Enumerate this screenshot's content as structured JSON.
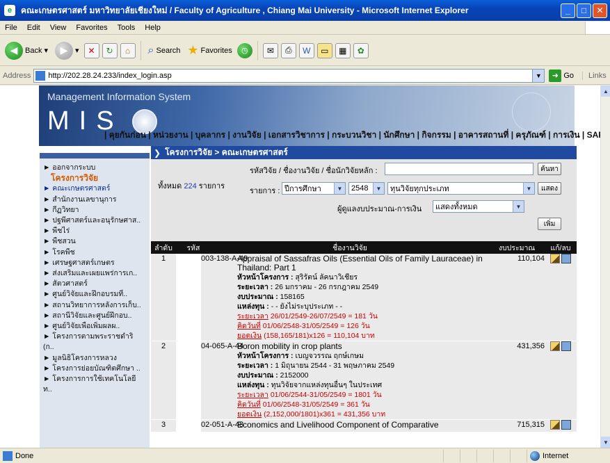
{
  "window": {
    "title": "คณะเกษตรศาสตร์ มหาวิทยาลัยเชียงใหม่ / Faculty of Agriculture , Chiang Mai University   - Microsoft Internet Explorer",
    "buttons": {
      "minimize": "_",
      "maximize": "□",
      "close": "✕"
    }
  },
  "menu": [
    "File",
    "Edit",
    "View",
    "Favorites",
    "Tools",
    "Help"
  ],
  "toolbar": {
    "back": "Back",
    "search": "Search",
    "favorites": "Favorites"
  },
  "address": {
    "label": "Address",
    "url": "http://202.28.24.233/index_login.asp",
    "go": "Go",
    "links": "Links"
  },
  "banner": {
    "subtitle": "Management Information System",
    "mis": "MIS"
  },
  "topnav": [
    "คุยกันก่อน",
    "หน่วยงาน",
    "บุคลากร",
    "งานวิจัย",
    "เอกสารวิชาการ",
    "กระบวนวิชา",
    "นักศึกษา",
    "กิจกรรม",
    "อาคารสถานที่",
    "ครุภัณฑ์",
    "การเงิน",
    "SAR"
  ],
  "sidebar": {
    "items": [
      {
        "label": "► ออกจากระบบ",
        "type": "normal"
      },
      {
        "label": "โครงการวิจัย",
        "type": "active"
      },
      {
        "label": "► คณะเกษตรศาสตร์",
        "type": "sel"
      },
      {
        "label": "► สำนักงานเลขานุการ",
        "type": "normal"
      },
      {
        "label": "► กีฏวิทยา",
        "type": "normal"
      },
      {
        "label": "► ปฐพีศาสตร์และอนุรักษศาส..",
        "type": "normal"
      },
      {
        "label": "► พืชไร่",
        "type": "normal"
      },
      {
        "label": "► พืชสวน",
        "type": "normal"
      },
      {
        "label": "► โรคพืช",
        "type": "normal"
      },
      {
        "label": "► เศรษฐศาสตร์เกษตร",
        "type": "normal"
      },
      {
        "label": "► ส่งเสริมและเผยแพร่การเก..",
        "type": "normal"
      },
      {
        "label": "► สัตวศาสตร์",
        "type": "normal"
      },
      {
        "label": "► ศูนย์วิจัยและฝึกอบรมที่..",
        "type": "normal"
      },
      {
        "label": "► สถานวิทยาการหลังการเก็บ..",
        "type": "normal"
      },
      {
        "label": "► สถานีวิจัยและศูนย์ฝึกอบ..",
        "type": "normal"
      },
      {
        "label": "► ศูนย์วิจัยเพื่อเพิ่มผลผ..",
        "type": "normal"
      },
      {
        "label": "► โครงการตามพระราชดำริ",
        "type": "normal"
      },
      {
        "label": "(ก..",
        "type": "normal"
      },
      {
        "label": "► มูลนิธิโครงการหลวง",
        "type": "normal"
      },
      {
        "label": "► โครงการย่อยบัณฑิตศึกษา ..",
        "type": "normal"
      },
      {
        "label": "► โครงการการใช้เทคโนโลยี",
        "type": "normal"
      },
      {
        "label": "ท..",
        "type": "normal"
      }
    ]
  },
  "breadcrumb": "โครงการวิจัย > คณะเกษตรศาสตร์",
  "form": {
    "search_label": "รหัสวิจัย / ชื่องานวิจัย / ชื่อนักวิจัยหลัก :",
    "search_value": "",
    "search_button": "ค้นหา",
    "total_prefix": "ทั้งหมด",
    "total_count": "224",
    "total_suffix": "รายการ",
    "list_label": "รายการ :",
    "year_type": "ปีการศึกษา",
    "year": "2548",
    "fund": "ทุนวิจัยทุกประเภท",
    "show_button": "แสดง",
    "owner_label": "ผู้ดูแลงบประมาณ-การเงิน",
    "owner": "แสดงทั้งหมด",
    "add_button": "เพิ่ม"
  },
  "table": {
    "headers": [
      "ลำดับ",
      "รหัส",
      "ชื่องานวิจัย",
      "งบประมาณ",
      "แก้/ลบ"
    ],
    "rows": [
      {
        "no": "1",
        "code": "003-138-A-49",
        "title": "Appraisal of Sassafras Oils (Essential Oils of Family Lauraceae) in Thailand: Part 1",
        "head_label": "หัวหน้าโครงการ :",
        "head": "สุริรัตน์ ลัคนาวิเชียร",
        "period_label": "ระยะเวลา :",
        "period": "26 มกราคม - 26 กรกฎาคม 2549",
        "budget_label": "งบประมาณ :",
        "budget_full": "158165",
        "fund_label": "แหล่งทุน :",
        "fund": "- - ยังไม่ระบุประเภท - -",
        "red1_k": "ระยะเวลา",
        "red1_v": "26/01/2549-26/07/2549 = 181 วัน",
        "red2_k": "คิดวันที่",
        "red2_v": "01/06/2548-31/05/2549 = 126 วัน",
        "red3_k": "ยอดเงิน",
        "red3_v": "(158,165/181)x126 = 110,104 บาท",
        "budget": "110,104"
      },
      {
        "no": "2",
        "code": "04-065-A-44",
        "title": "Boron mobility in crop plants",
        "head_label": "หัวหน้าโครงการ :",
        "head": "เบญจวรรณ ฤกษ์เกษม",
        "period_label": "ระยะเวลา :",
        "period": "1 มิถุนายน 2544 - 31 พฤษภาคม 2549",
        "budget_label": "งบประมาณ :",
        "budget_full": "2152000",
        "fund_label": "แหล่งทุน :",
        "fund": "ทุนวิจัยจากแหล่งทุนอื่นๆ ในประเทศ",
        "red1_k": "ระยะเวลา",
        "red1_v": "01/06/2544-31/05/2549 = 1801 วัน",
        "red2_k": "คิดวันที่",
        "red2_v": "01/06/2548-31/05/2549 = 361 วัน",
        "red3_k": "ยอดเงิน",
        "red3_v": "(2,152,000/1801)x361 = 431,356 บาท",
        "budget": "431,356"
      },
      {
        "no": "3",
        "code": "02-051-A-48",
        "title": "Economics and Livelihood Component of Comparative",
        "budget": "715,315"
      }
    ]
  },
  "status": {
    "text": "Done",
    "zone": "Internet"
  }
}
